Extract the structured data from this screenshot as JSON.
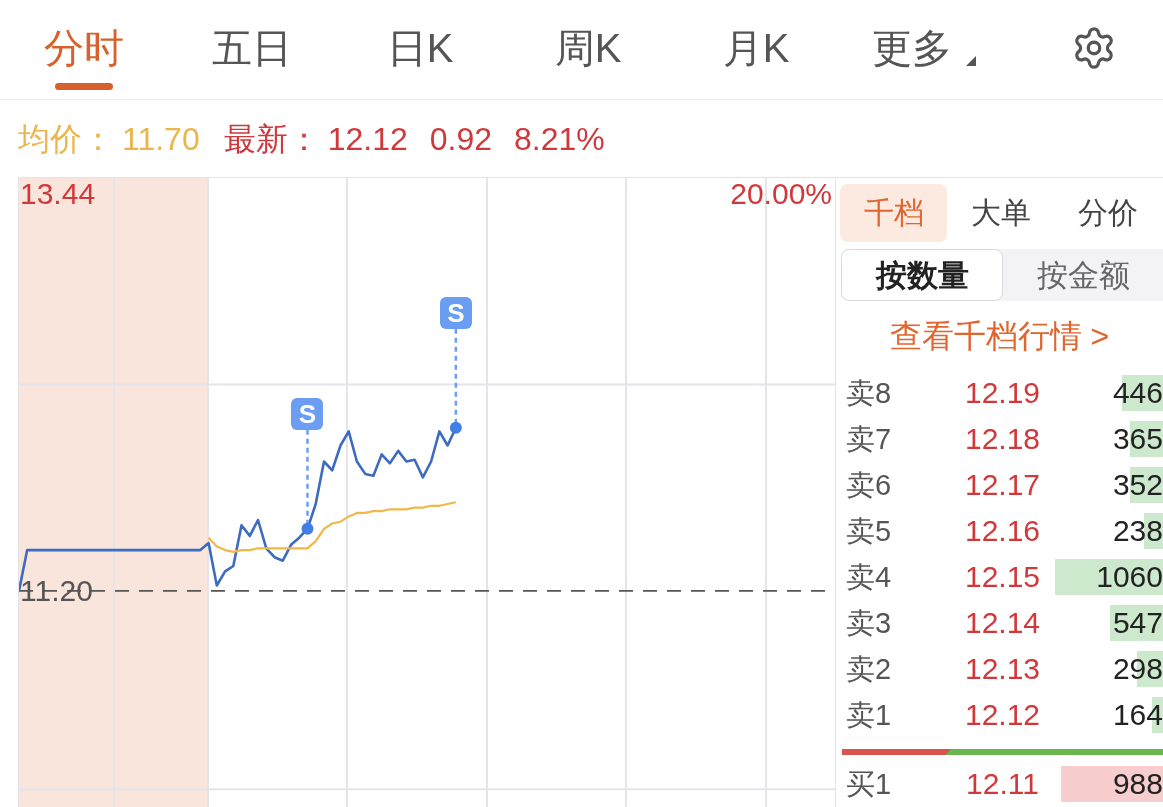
{
  "tabs": [
    {
      "label": "分时",
      "selected": true,
      "dropdown": false
    },
    {
      "label": "五日",
      "selected": false,
      "dropdown": false
    },
    {
      "label": "日K",
      "selected": false,
      "dropdown": false
    },
    {
      "label": "周K",
      "selected": false,
      "dropdown": false
    },
    {
      "label": "月K",
      "selected": false,
      "dropdown": false
    },
    {
      "label": "更多",
      "selected": false,
      "dropdown": true
    }
  ],
  "quote": {
    "avg_label": "均价：",
    "avg": "11.70",
    "last_label": "最新：",
    "last": "12.12",
    "change": "0.92",
    "change_pct": "8.21%"
  },
  "chart": {
    "chart_data": [
      {
        "type": "line",
        "ylim": [
          9.98,
          13.53
        ],
        "yticks": [
          {
            "value": 13.44,
            "label": "13.44"
          },
          {
            "value": 11.2,
            "label": "11.20"
          }
        ],
        "tick_labels": "y",
        "grid": true,
        "categories": [
          null,
          null,
          null,
          null,
          null,
          null,
          null,
          null,
          null,
          null,
          null,
          null,
          null,
          null,
          null,
          null,
          null,
          null,
          null,
          null,
          null,
          null,
          null,
          null,
          null,
          null,
          null,
          null,
          null,
          null,
          null,
          null,
          null,
          null,
          null,
          null,
          null,
          null,
          null,
          null,
          null,
          null,
          null,
          null,
          null,
          null,
          null,
          null,
          null,
          null,
          null,
          null,
          null,
          null,
          null,
          null,
          null,
          null,
          null,
          null,
          null,
          null,
          null,
          null,
          null,
          null,
          null,
          null,
          null,
          null,
          null,
          null,
          null,
          null,
          null,
          null,
          null,
          null,
          null,
          null,
          null,
          null,
          null,
          null,
          null,
          null,
          null,
          null,
          null,
          null,
          null,
          null,
          null,
          null,
          null,
          null,
          null,
          null,
          null,
          null
        ],
        "series": [
          {
            "color": "#3d6bbf",
            "values": [
              11.2,
              11.43,
              11.43,
              11.43,
              11.43,
              11.43,
              11.43,
              11.43,
              11.43,
              11.43,
              11.43,
              11.43,
              11.43,
              11.43,
              11.43,
              11.43,
              11.43,
              11.43,
              11.43,
              11.43,
              11.43,
              11.43,
              11.43,
              11.47,
              11.23,
              11.31,
              11.34,
              11.57,
              11.51,
              11.6,
              11.44,
              11.39,
              11.37,
              11.46,
              11.5,
              11.55,
              11.69,
              11.93,
              11.88,
              12.02,
              12.1,
              11.93,
              11.86,
              11.85,
              11.97,
              11.92,
              11.99,
              11.93,
              11.94,
              11.84,
              11.93,
              12.1,
              12.02,
              12.12,
              null,
              null,
              null,
              null,
              null,
              null,
              null,
              null,
              null,
              null,
              null,
              null,
              null,
              null,
              null,
              null,
              null,
              null,
              null,
              null,
              null,
              null,
              null,
              null,
              null,
              null,
              null,
              null,
              null,
              null,
              null,
              null,
              null,
              null,
              null,
              null,
              null,
              null,
              null,
              null,
              null,
              null,
              null,
              null,
              null,
              null
            ]
          },
          {
            "color": "#f0b84a",
            "values": [
              null,
              null,
              null,
              null,
              null,
              null,
              null,
              null,
              null,
              null,
              null,
              null,
              null,
              null,
              null,
              null,
              null,
              null,
              null,
              null,
              null,
              null,
              null,
              11.5,
              11.45,
              11.43,
              11.42,
              11.43,
              11.43,
              11.44,
              11.44,
              11.44,
              11.44,
              11.44,
              11.44,
              11.44,
              11.48,
              11.55,
              11.58,
              11.59,
              11.62,
              11.64,
              11.64,
              11.65,
              11.65,
              11.66,
              11.66,
              11.66,
              11.67,
              11.67,
              11.68,
              11.68,
              11.69,
              11.7,
              null,
              null,
              null,
              null,
              null,
              null,
              null,
              null,
              null,
              null,
              null,
              null,
              null,
              null,
              null,
              null,
              null,
              null,
              null,
              null,
              null,
              null,
              null,
              null,
              null,
              null,
              null,
              null,
              null,
              null,
              null,
              null,
              null,
              null,
              null,
              null,
              null,
              null,
              null,
              null,
              null,
              null,
              null,
              null,
              null,
              null
            ]
          }
        ],
        "ref_lines": [
          {
            "axis": "y",
            "value": 11.2,
            "color": "#555555",
            "line_style": "dashed"
          }
        ],
        "annotations": [
          "20.00%",
          "S",
          "S"
        ]
      }
    ]
  },
  "order_book": {
    "tabs": [
      {
        "label": "千档",
        "selected": true
      },
      {
        "label": "大单",
        "selected": false
      },
      {
        "label": "分价",
        "selected": false
      }
    ],
    "modes": [
      {
        "label": "按数量",
        "selected": true
      },
      {
        "label": "按金额",
        "selected": false
      }
    ],
    "link": "查看千档行情 >",
    "rows": [
      {
        "kind": "ask",
        "label": "卖8",
        "price": "12.19",
        "volume": "446",
        "level": 0.38
      },
      {
        "kind": "ask",
        "label": "卖7",
        "price": "12.18",
        "volume": "365",
        "level": 0.31
      },
      {
        "kind": "ask",
        "label": "卖6",
        "price": "12.17",
        "volume": "352",
        "level": 0.31
      },
      {
        "kind": "ask",
        "label": "卖5",
        "price": "12.16",
        "volume": "238",
        "level": 0.18
      },
      {
        "kind": "ask",
        "label": "卖4",
        "price": "12.15",
        "volume": "1060",
        "level": 1.0
      },
      {
        "kind": "ask",
        "label": "卖3",
        "price": "12.14",
        "volume": "547",
        "level": 0.49
      },
      {
        "kind": "ask",
        "label": "卖2",
        "price": "12.13",
        "volume": "298",
        "level": 0.24
      },
      {
        "kind": "ask",
        "label": "卖1",
        "price": "12.12",
        "volume": "164",
        "level": 0.1
      },
      {
        "kind": "bid",
        "label": "买1",
        "price": "12.11",
        "volume": "988",
        "level": 0.94
      }
    ],
    "ratio_bar": {
      "level": 0.34
    }
  }
}
